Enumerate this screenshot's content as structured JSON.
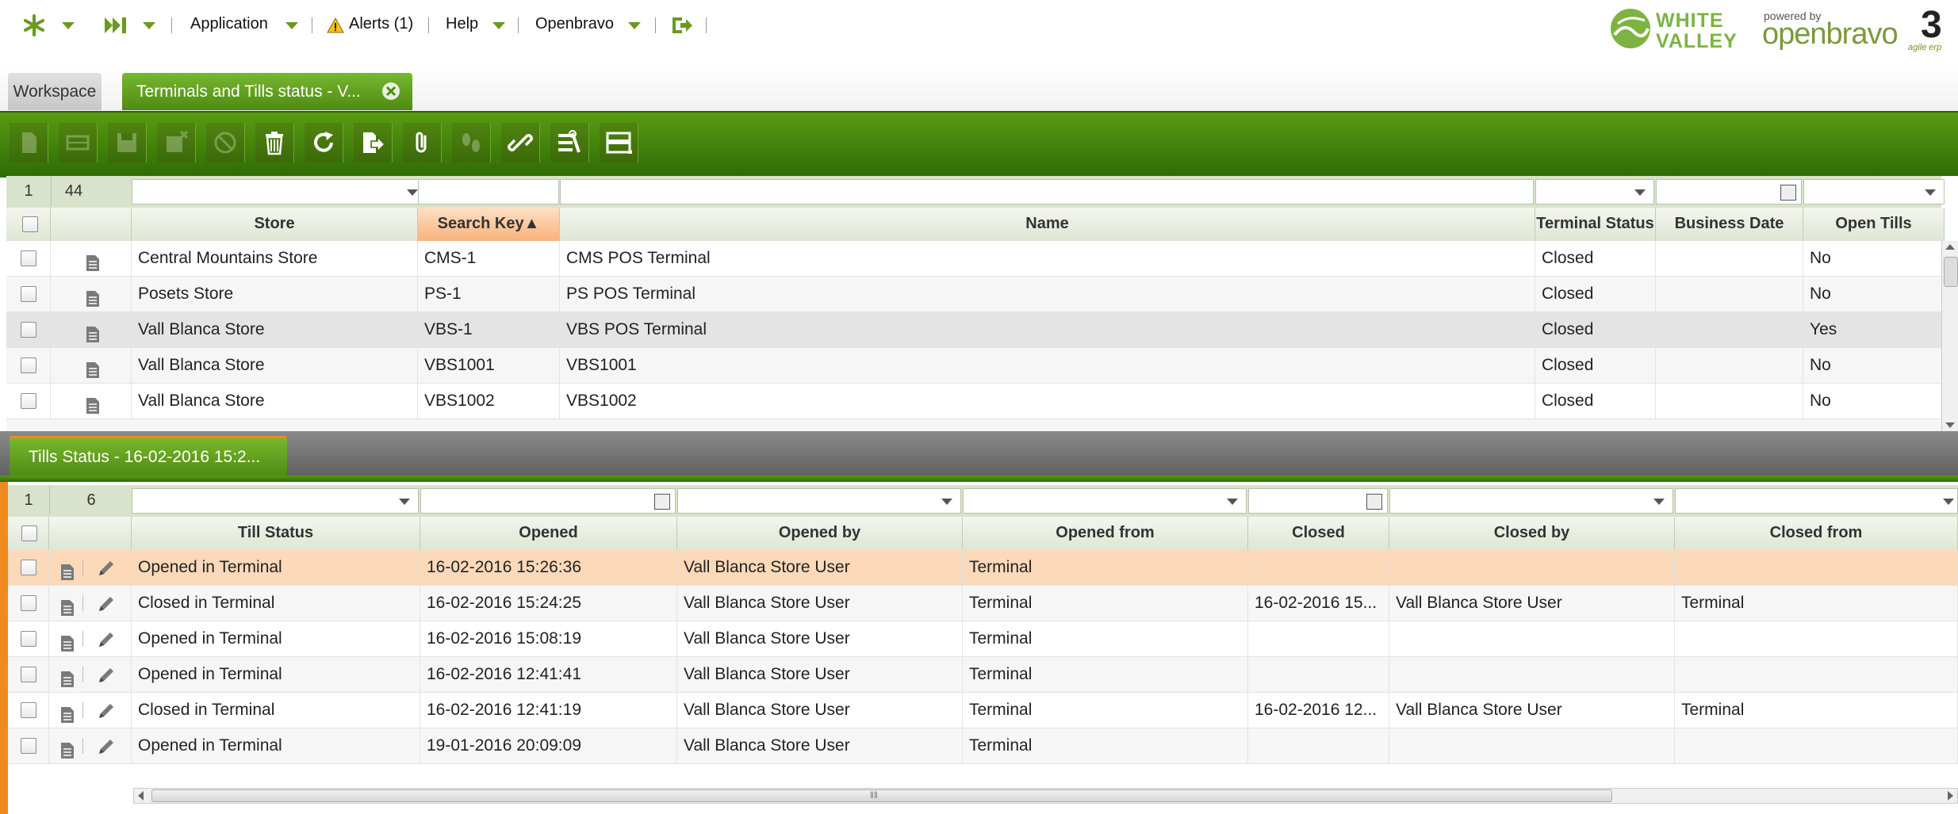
{
  "nav": {
    "application": "Application",
    "alerts": "Alerts (1)",
    "help": "Help",
    "openbravo": "Openbravo"
  },
  "branding": {
    "white_valley_line1": "WHITE",
    "white_valley_line2": "VALLEY",
    "powered_by": "powered by",
    "openbravo_logo": "openbravo",
    "version": "3",
    "tagline": "agile erp"
  },
  "tabs": {
    "workspace": "Workspace",
    "active": "Terminals and Tills status - V..."
  },
  "toolbar_icons": [
    "new-doc-icon",
    "new-row-icon",
    "save-icon",
    "save-close-icon",
    "undo-icon",
    "delete-icon",
    "refresh-icon",
    "export-icon",
    "attachment-icon",
    "audit-trail-icon",
    "link-icon",
    "tools-icon",
    "grid-view-icon"
  ],
  "terminals": {
    "selected": "1",
    "total": "44",
    "columns": {
      "store": "Store",
      "search_key": "Search Key",
      "name": "Name",
      "terminal_status": "Terminal Status",
      "business_date": "Business Date",
      "open_tills": "Open Tills"
    },
    "rows": [
      {
        "store": "Central Mountains Store",
        "key": "CMS-1",
        "name": "CMS POS Terminal",
        "status": "Closed",
        "date": "",
        "open": "No"
      },
      {
        "store": "Posets Store",
        "key": "PS-1",
        "name": "PS POS Terminal",
        "status": "Closed",
        "date": "",
        "open": "No"
      },
      {
        "store": "Vall Blanca Store",
        "key": "VBS-1",
        "name": "VBS POS Terminal",
        "status": "Closed",
        "date": "",
        "open": "Yes"
      },
      {
        "store": "Vall Blanca Store",
        "key": "VBS1001",
        "name": "VBS1001",
        "status": "Closed",
        "date": "",
        "open": "No"
      },
      {
        "store": "Vall Blanca Store",
        "key": "VBS1002",
        "name": "VBS1002",
        "status": "Closed",
        "date": "",
        "open": "No"
      }
    ]
  },
  "tills": {
    "tab_label": "Tills Status - 16-02-2016 15:2...",
    "selected": "1",
    "total": "6",
    "columns": {
      "till_status": "Till Status",
      "opened": "Opened",
      "opened_by": "Opened by",
      "opened_from": "Opened from",
      "closed": "Closed",
      "closed_by": "Closed by",
      "closed_from": "Closed from"
    },
    "rows": [
      {
        "status": "Opened in Terminal",
        "opened": "16-02-2016 15:26:36",
        "opened_by": "Vall Blanca Store User",
        "opened_from": "Terminal",
        "closed": "",
        "closed_by": "",
        "closed_from": ""
      },
      {
        "status": "Closed in Terminal",
        "opened": "16-02-2016 15:24:25",
        "opened_by": "Vall Blanca Store User",
        "opened_from": "Terminal",
        "closed": "16-02-2016 15...",
        "closed_by": "Vall Blanca Store User",
        "closed_from": "Terminal"
      },
      {
        "status": "Opened in Terminal",
        "opened": "16-02-2016 15:08:19",
        "opened_by": "Vall Blanca Store User",
        "opened_from": "Terminal",
        "closed": "",
        "closed_by": "",
        "closed_from": ""
      },
      {
        "status": "Opened in Terminal",
        "opened": "16-02-2016 12:41:41",
        "opened_by": "Vall Blanca Store User",
        "opened_from": "Terminal",
        "closed": "",
        "closed_by": "",
        "closed_from": ""
      },
      {
        "status": "Closed in Terminal",
        "opened": "16-02-2016 12:41:19",
        "opened_by": "Vall Blanca Store User",
        "opened_from": "Terminal",
        "closed": "16-02-2016 12...",
        "closed_by": "Vall Blanca Store User",
        "closed_from": "Terminal"
      },
      {
        "status": "Opened in Terminal",
        "opened": "19-01-2016 20:09:09",
        "opened_by": "Vall Blanca Store User",
        "opened_from": "Terminal",
        "closed": "",
        "closed_by": "",
        "closed_from": ""
      }
    ]
  },
  "colors": {
    "brand_green": "#3f7a0b",
    "selected_row": "#fcd9b8",
    "sorted_header": "#f9b27a",
    "accent_orange": "#f0891e"
  }
}
